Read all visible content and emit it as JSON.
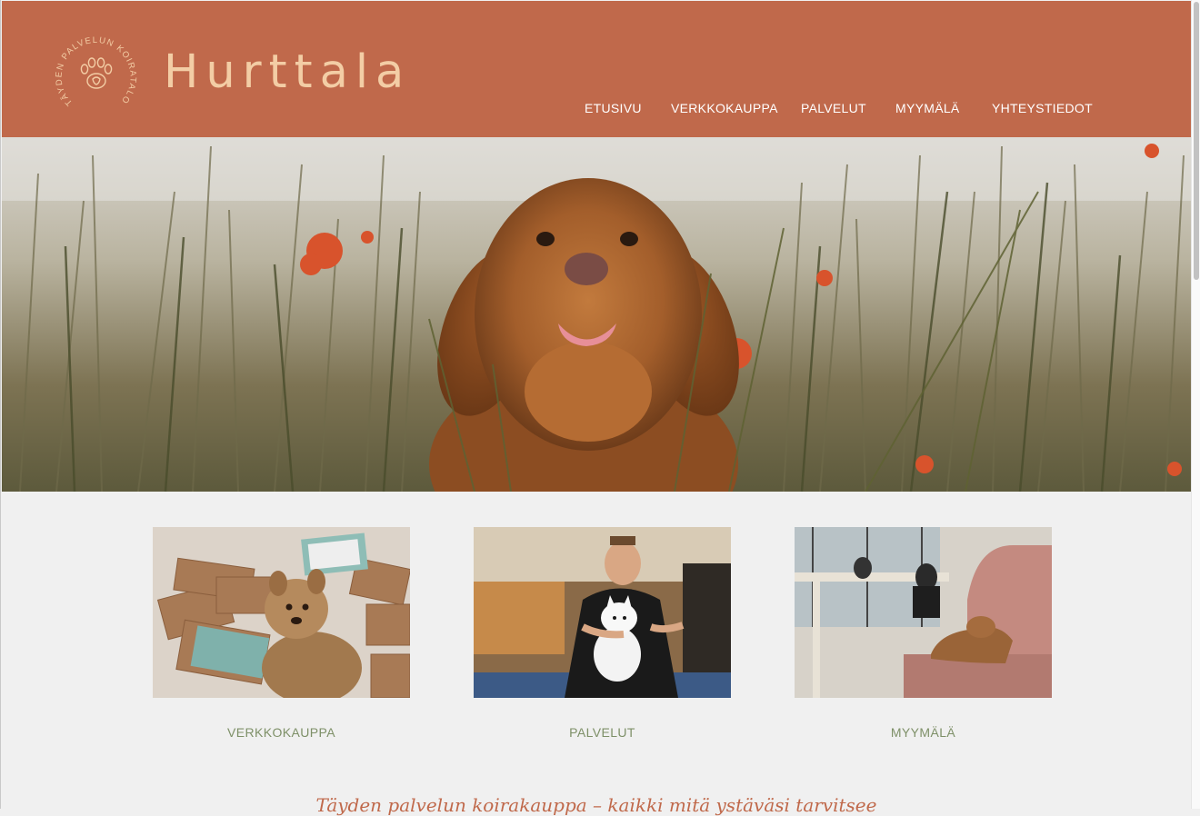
{
  "brand": {
    "name": "Hurttala",
    "badge_text": "TÄYDEN PALVELUN KOIRATALO"
  },
  "nav": {
    "items": [
      {
        "label": "ETUSIVU"
      },
      {
        "label": "VERKKOKAUPPA"
      },
      {
        "label": "PALVELUT"
      },
      {
        "label": "MYYMÄLÄ"
      },
      {
        "label": "YHTEYSTIEDOT"
      }
    ]
  },
  "cards": [
    {
      "label": "VERKKOKAUPPA"
    },
    {
      "label": "PALVELUT"
    },
    {
      "label": "MYYMÄLÄ"
    }
  ],
  "tagline": "Täyden palvelun koirakauppa – kaikki mitä ystäväsi tarvitsee",
  "colors": {
    "header_bg": "#c0694b",
    "logo": "#f3cda5",
    "card_label": "#7e9068",
    "page_bg": "#f0f0f0"
  }
}
